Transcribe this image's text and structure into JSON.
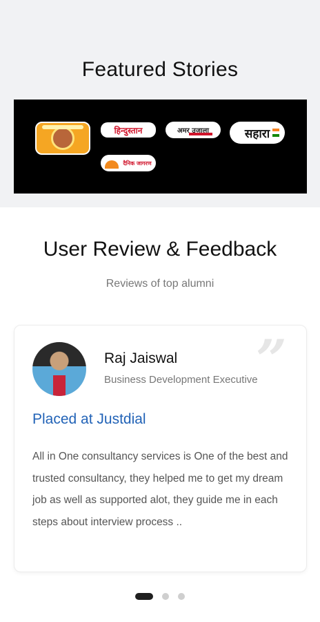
{
  "featured": {
    "title": "Featured Stories",
    "logos": [
      {
        "name": "newspaper-logo-1",
        "label": ""
      },
      {
        "name": "hindustan-logo",
        "label": "हिन्दुस्तान"
      },
      {
        "name": "amar-ujala-logo",
        "label": "अमर उजाला"
      },
      {
        "name": "sahara-logo",
        "label": "सहारा"
      },
      {
        "name": "dainik-jagran-logo",
        "label": "दैनिक जागरण"
      }
    ]
  },
  "reviews": {
    "title": "User Review & Feedback",
    "subtitle": "Reviews of top alumni",
    "items": [
      {
        "name": "Raj Jaiswal",
        "role": "Business Development Executive",
        "placed": "Placed at Justdial",
        "text": "All in One consultancy services is One of the best and trusted consultancy, they helped me to get my dream job as well as supported alot, they guide me in each steps about interview process .."
      }
    ]
  },
  "carousel": {
    "active_index": 0,
    "count": 3
  },
  "colors": {
    "accent": "#2263b7",
    "strip": "#000000",
    "section_bg": "#f1f2f4"
  }
}
